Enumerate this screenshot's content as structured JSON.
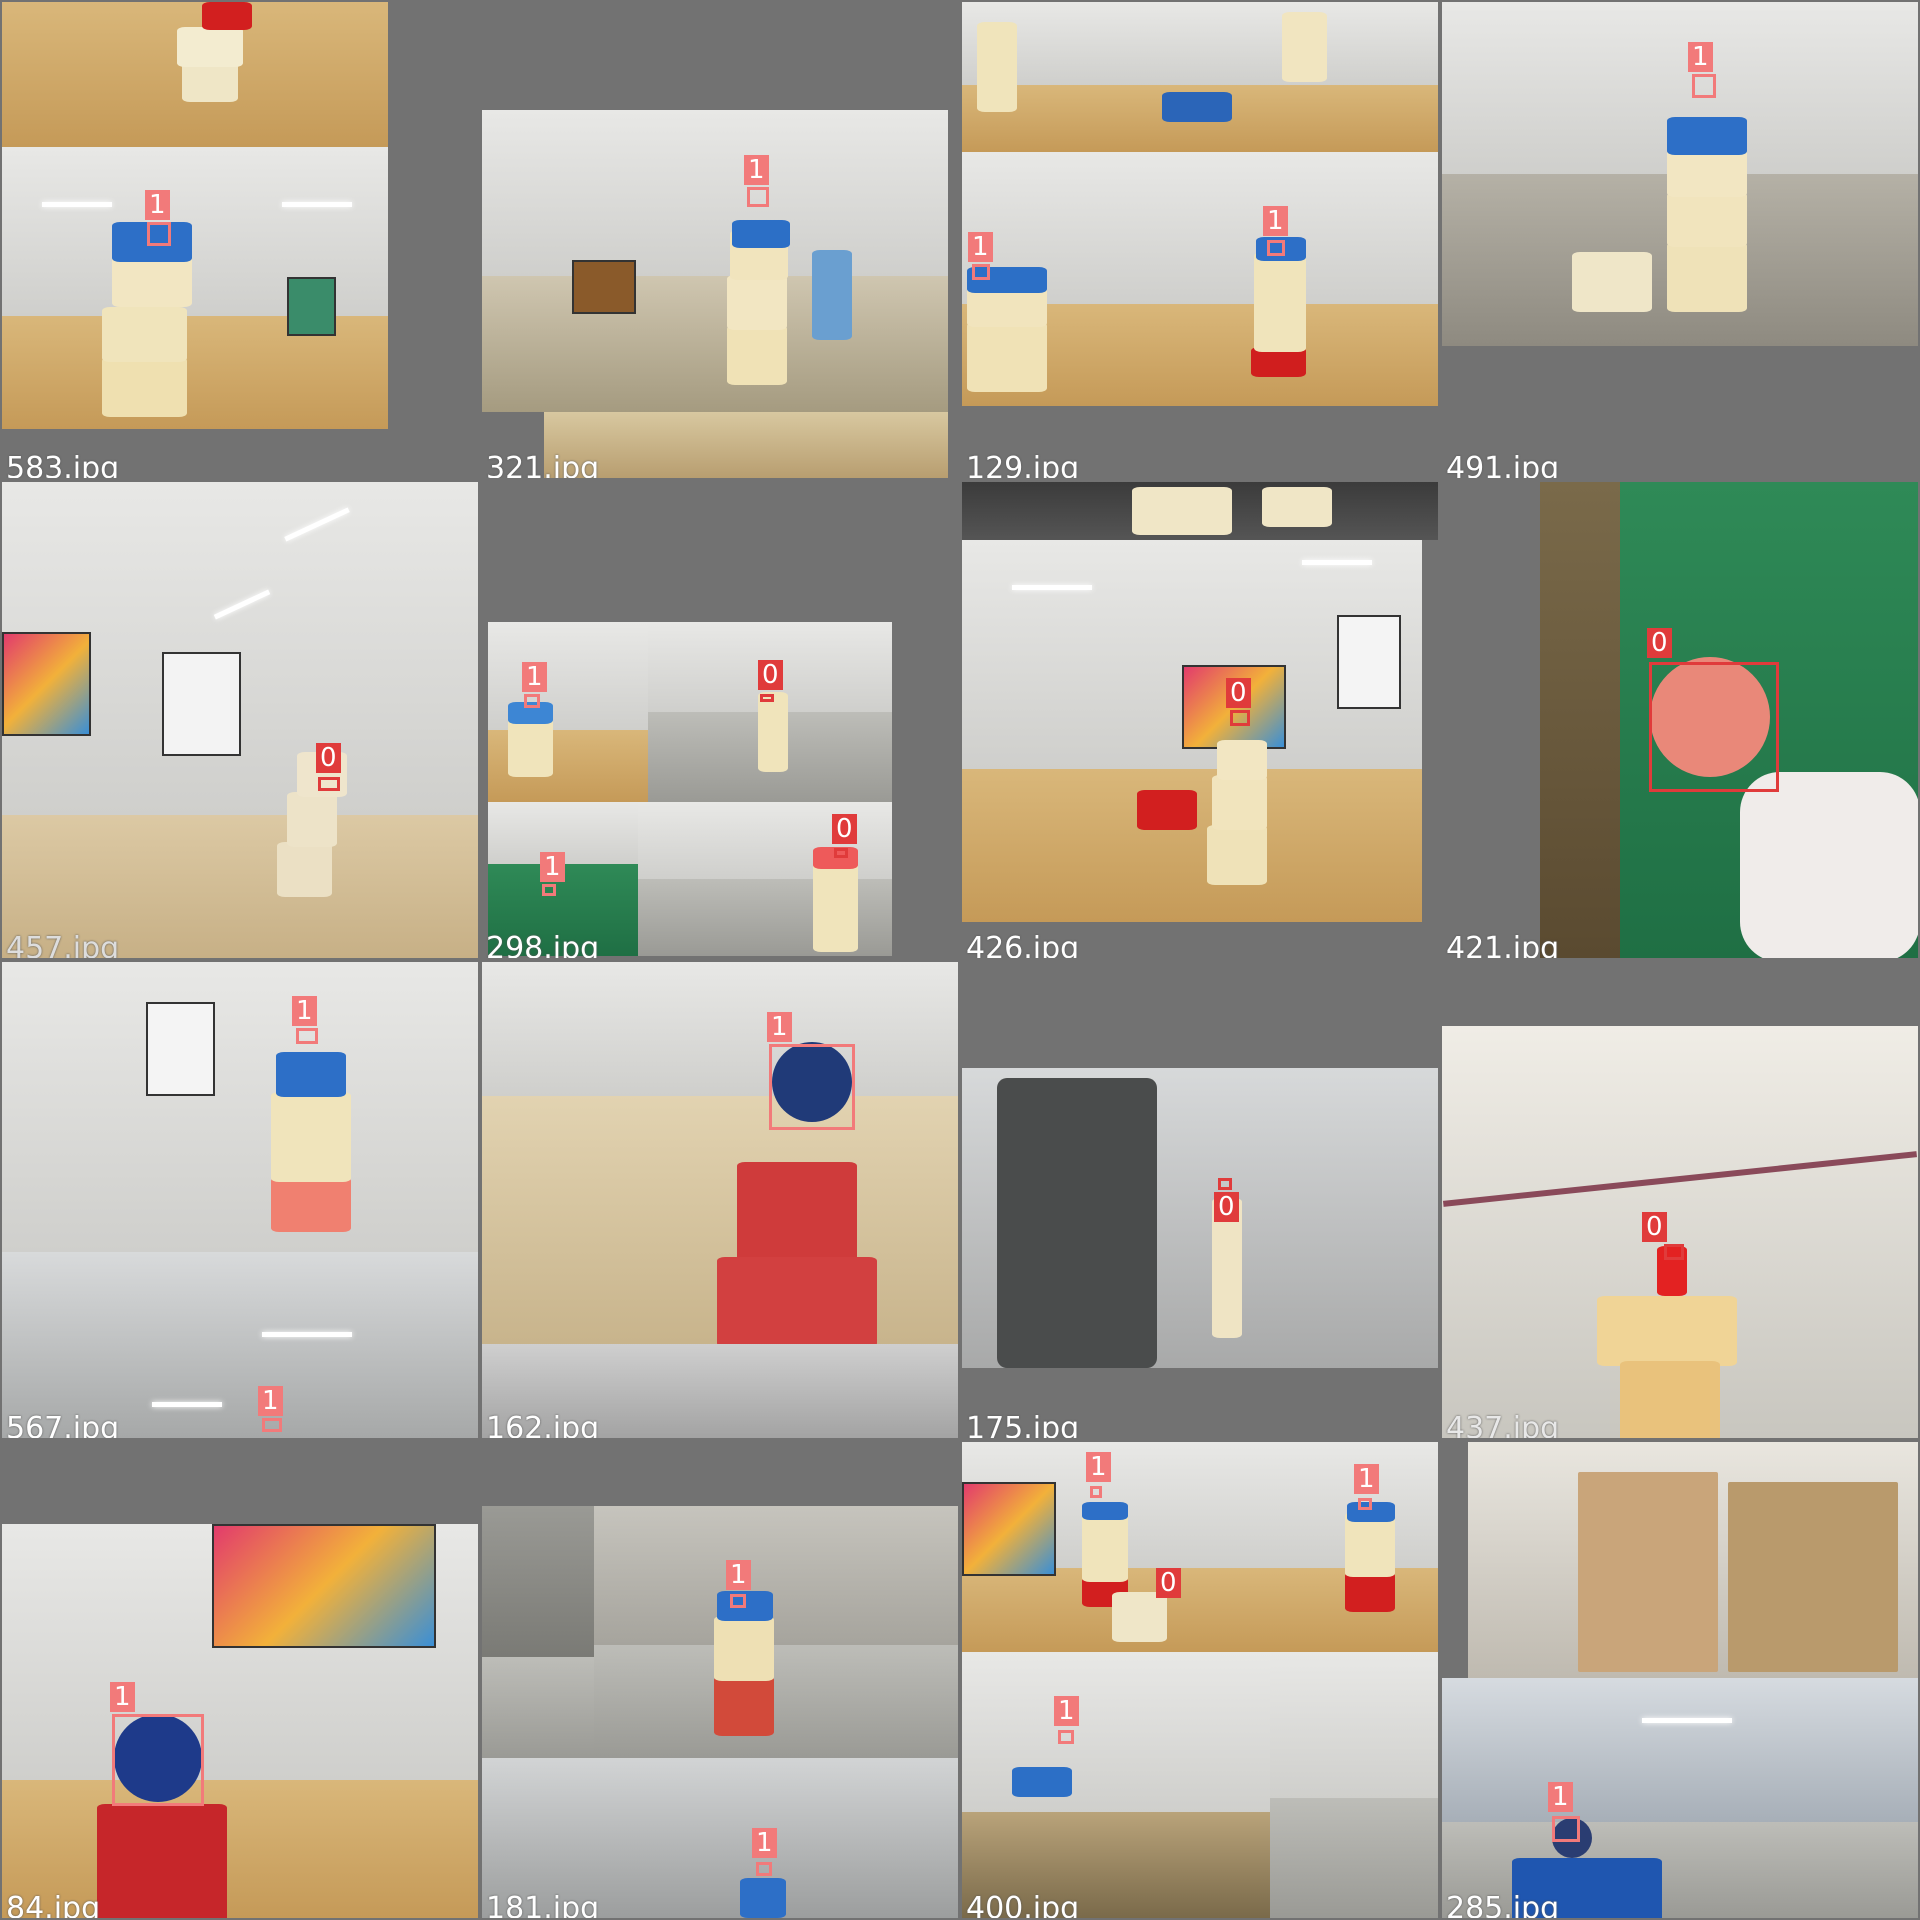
{
  "tiles": [
    {
      "filename": "583.jpg",
      "labels": [
        "1"
      ]
    },
    {
      "filename": "321.jpg",
      "labels": [
        "1"
      ]
    },
    {
      "filename": "129.jpg",
      "labels": [
        "1",
        "1"
      ]
    },
    {
      "filename": "491.jpg",
      "labels": [
        "1"
      ]
    },
    {
      "filename": "457.jpg",
      "labels": [
        "0"
      ]
    },
    {
      "filename": "298.jpg",
      "labels": [
        "1",
        "0",
        "0",
        "1"
      ]
    },
    {
      "filename": "426.jpg",
      "labels": [
        "0"
      ]
    },
    {
      "filename": "421.jpg",
      "labels": [
        "0"
      ]
    },
    {
      "filename": "567.jpg",
      "labels": [
        "1",
        "1"
      ]
    },
    {
      "filename": "162.jpg",
      "labels": [
        "1"
      ]
    },
    {
      "filename": "175.jpg",
      "labels": [
        "0"
      ]
    },
    {
      "filename": "437.jpg",
      "labels": [
        "0"
      ]
    },
    {
      "filename": "84.jpg",
      "labels": [
        "1"
      ]
    },
    {
      "filename": "181.jpg",
      "labels": [
        "1",
        "1"
      ]
    },
    {
      "filename": "400.jpg",
      "labels": [
        "1",
        "0",
        "1",
        "1"
      ]
    },
    {
      "filename": "285.jpg",
      "labels": [
        "1"
      ]
    }
  ],
  "colors": {
    "class_0": "#e03b3b",
    "class_1": "#f27a7a",
    "background": "#727272"
  }
}
